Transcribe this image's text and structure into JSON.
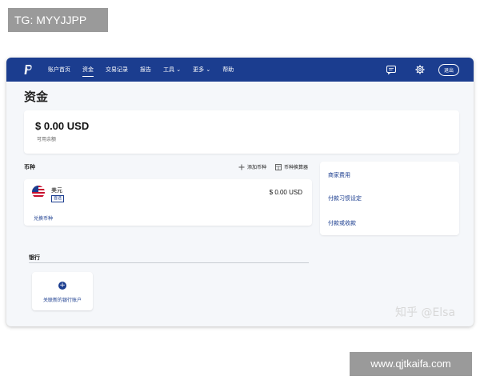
{
  "watermarks": {
    "top": "TG: MYYJJPP",
    "zhihu": "知乎 @Elsa",
    "bottom": "www.qjtkaifa.com"
  },
  "nav": {
    "logo": "paypal-logo",
    "items": [
      {
        "label": "账户首页",
        "active": false
      },
      {
        "label": "资金",
        "active": true
      },
      {
        "label": "交易记录",
        "active": false
      },
      {
        "label": "报告",
        "active": false
      },
      {
        "label": "工具 ⌄",
        "active": false
      },
      {
        "label": "更多 ⌄",
        "active": false
      },
      {
        "label": "帮助",
        "active": false
      }
    ],
    "logout_label": "退出"
  },
  "page": {
    "title": "资金"
  },
  "balance": {
    "amount": "$ 0.00 USD",
    "label": "可用余额"
  },
  "currencies": {
    "title": "币种",
    "add_label": "添加币种",
    "calculator_label": "币种换算器",
    "items": [
      {
        "name": "美元",
        "badge": "首选",
        "amount": "$ 0.00 USD"
      }
    ],
    "convert_link": "兑换币种"
  },
  "side_links": [
    "商家费用",
    "付款习惯设定",
    "付款或收款"
  ],
  "banks": {
    "title": "银行",
    "link_label": "关联新的银行账户"
  },
  "colors": {
    "nav_bg": "#1b3d8f",
    "link": "#1b3d8f",
    "page_bg": "#f5f7fa"
  }
}
